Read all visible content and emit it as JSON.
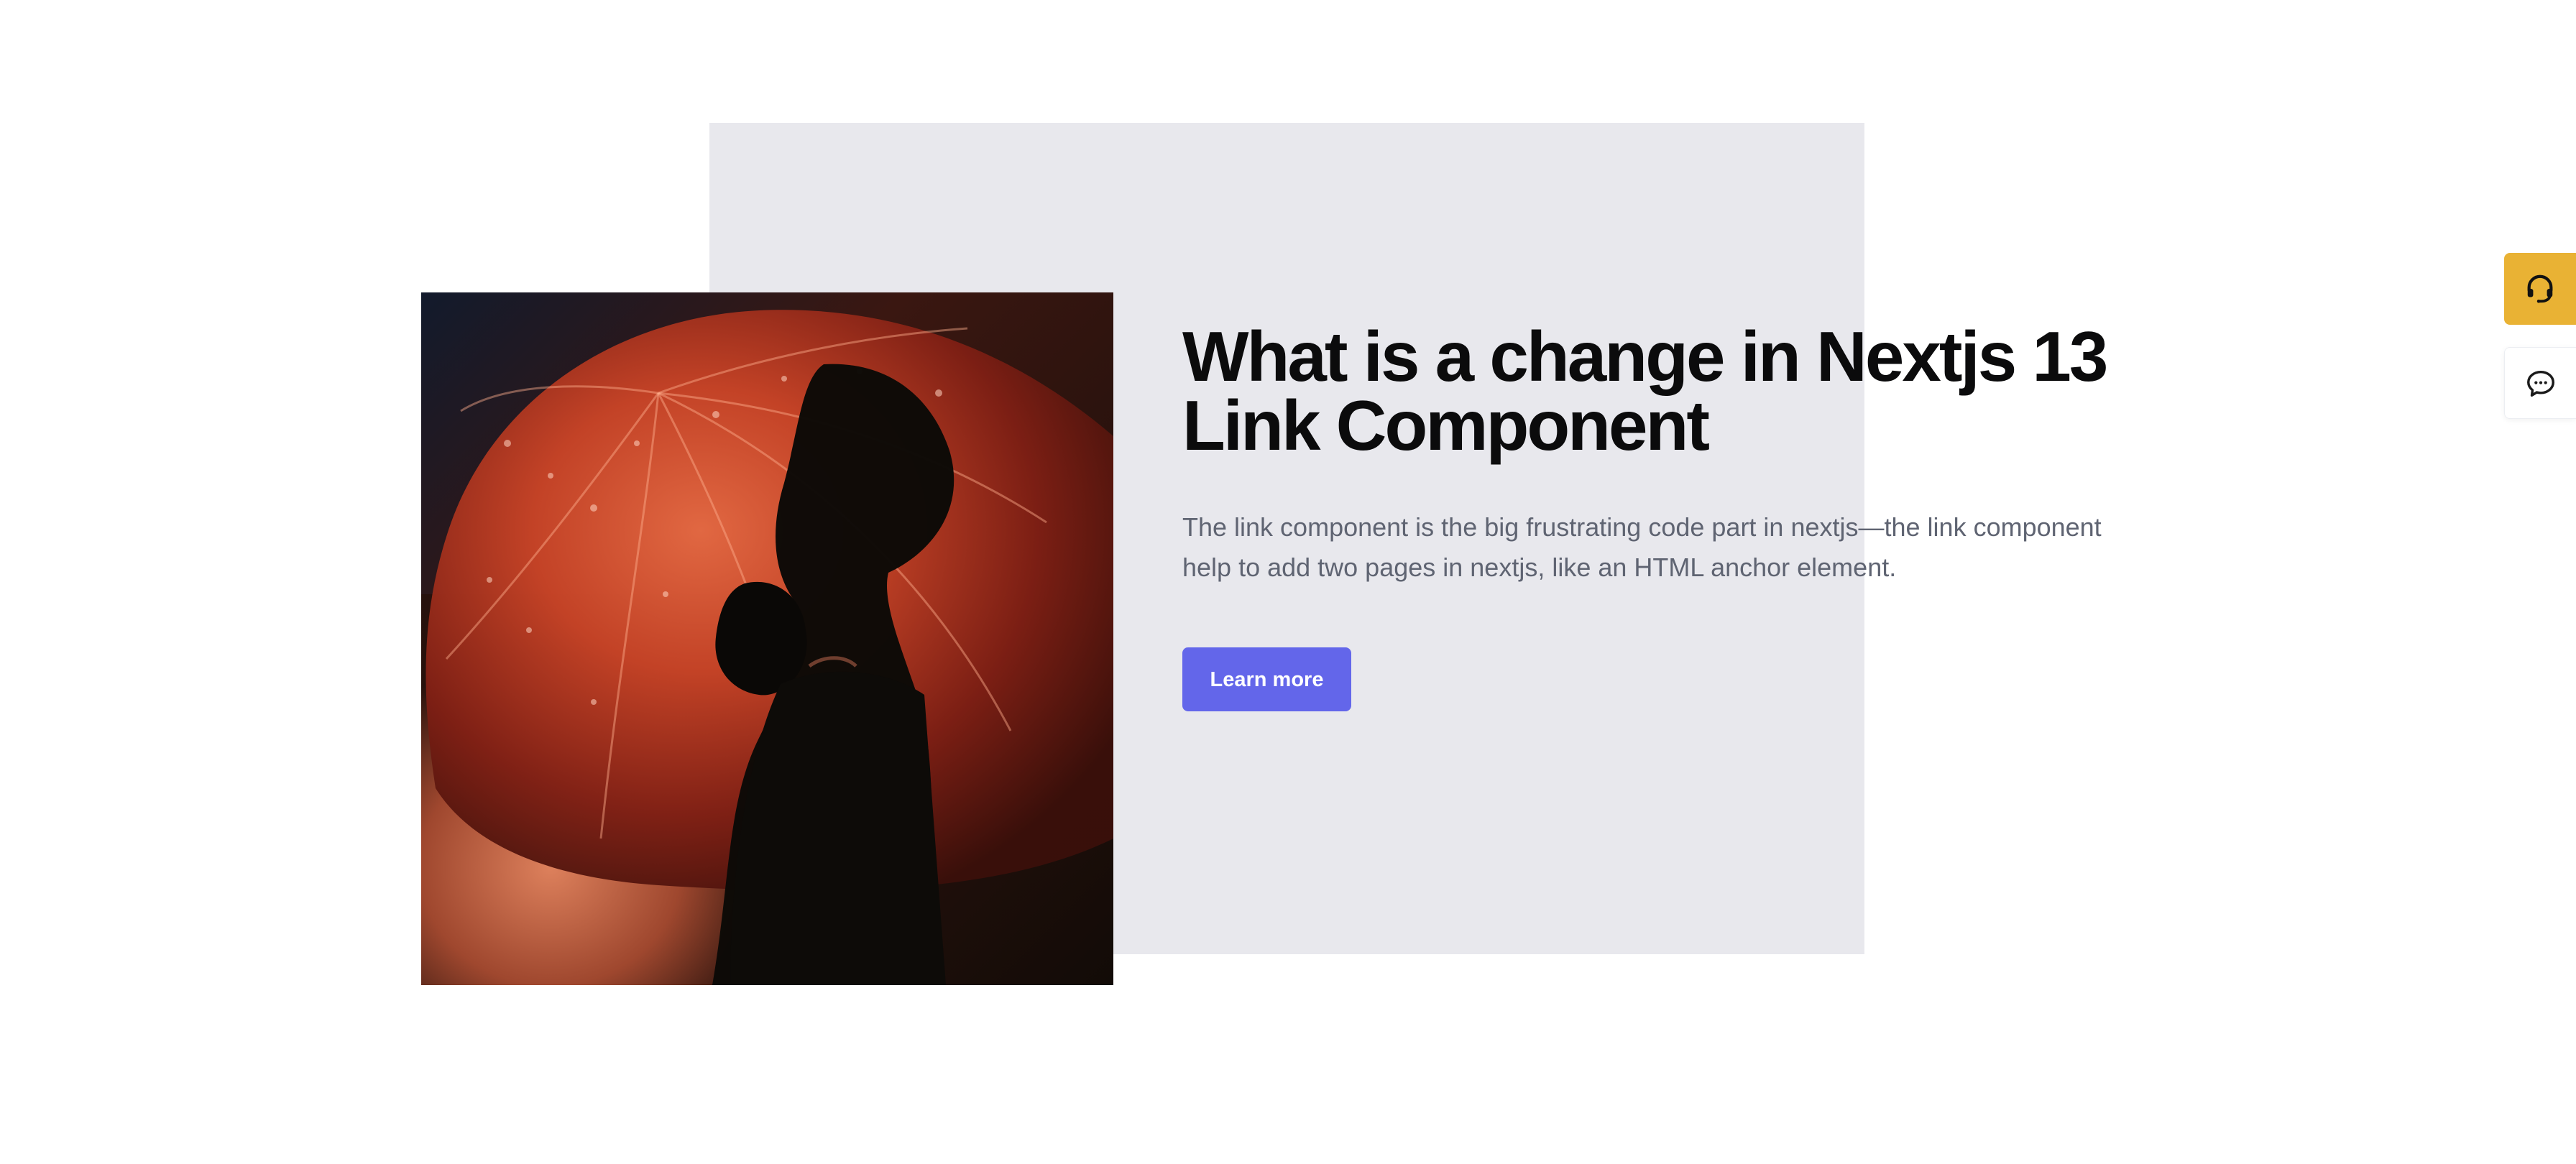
{
  "hero": {
    "title": "What is a change in Nextjs 13 Link Component",
    "description": "The link component is the big frustrating code part in nextjs—the link component help to add two pages in nextjs, like an HTML anchor element.",
    "button_label": "Learn more",
    "image_icon": "umbrella-photo"
  },
  "side_actions": {
    "support_icon": "headset-icon",
    "chat_icon": "chat-bubble-icon"
  },
  "colors": {
    "accent": "#6366ea",
    "panel": "#e8e8ed",
    "support": "#e9b234",
    "title": "#0b0b0c",
    "description": "#5f6472"
  }
}
